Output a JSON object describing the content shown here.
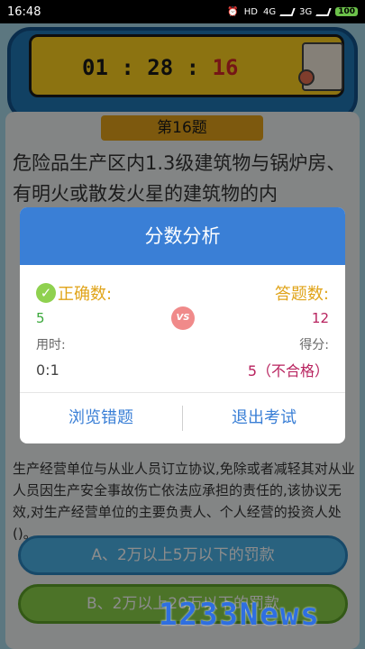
{
  "status": {
    "time": "16:48",
    "hd": "HD",
    "net1": "4G",
    "net2": "3G",
    "battery": "100"
  },
  "timer": {
    "hours": "01",
    "sep1": ":",
    "minutes": "28",
    "sep2": ":",
    "seconds": "16"
  },
  "question": {
    "number": "第16题",
    "text": "危险品生产区内1.3级建筑物与锅炉房、有明火或散发火星的建筑物的内",
    "text2": "生产经营单位与从业人员订立协议,免除或者减轻其对从业人员因生产安全事故伤亡依法应承担的责任的,该协议无效,对生产经营单位的主要负责人、个人经营的投资人处()。"
  },
  "options": [
    {
      "label": "A、2万以上5万以下的罚款"
    },
    {
      "label": "B、2万以上20万以下的罚款"
    }
  ],
  "dialog": {
    "title": "分数分析",
    "correct_label": "正确数:",
    "correct_value": "5",
    "answered_label": "答题数:",
    "answered_value": "12",
    "vs": "VS",
    "time_label": "用时:",
    "time_value": "0:1",
    "score_label": "得分:",
    "score_value": "5（不合格）",
    "btn_review": "浏览错题",
    "btn_exit": "退出考试"
  },
  "watermark": "1233News",
  "colors": {
    "accent": "#3a7fd6",
    "gold": "#e0a41a",
    "green": "#3aa83a",
    "red": "#b8225e"
  }
}
